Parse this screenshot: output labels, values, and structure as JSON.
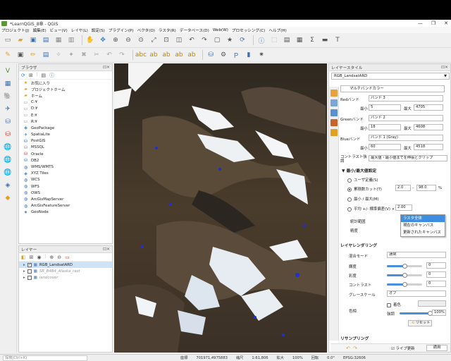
{
  "window": {
    "title": "*LearnQGIS_8章 - QGIS",
    "controls": [
      "—",
      "❐",
      "✕"
    ]
  },
  "menu": [
    "プロジェクト(J)",
    "編集(E)",
    "ビュー(V)",
    "レイヤ(L)",
    "設定(S)",
    "プラグイン(P)",
    "ベクタ(O)",
    "ラスタ(R)",
    "データベース(D)",
    "Web(W)",
    "プロセッシング(C)",
    "ヘルプ(H)"
  ],
  "browser": {
    "title": "ブラウザ",
    "items": [
      {
        "icon": "star-icon",
        "label": "お気に入り"
      },
      {
        "icon": "folder-icon",
        "label": "プロジェクトホーム"
      },
      {
        "icon": "folder-icon",
        "label": "ホーム"
      },
      {
        "icon": "drive-icon",
        "label": "C:¥"
      },
      {
        "icon": "drive-icon",
        "label": "D:¥"
      },
      {
        "icon": "drive-icon",
        "label": "E:¥"
      },
      {
        "icon": "drive-icon",
        "label": "R:¥"
      },
      {
        "icon": "geopackage-icon",
        "label": "GeoPackage"
      },
      {
        "icon": "spatialite-icon",
        "label": "SpatiaLite"
      },
      {
        "icon": "postgis-icon",
        "label": "PostGIS"
      },
      {
        "icon": "mssql-icon",
        "label": "MSSQL"
      },
      {
        "icon": "oracle-icon",
        "label": "Oracle"
      },
      {
        "icon": "db2-icon",
        "label": "DB2"
      },
      {
        "icon": "wms-icon",
        "label": "WMS/WMTS"
      },
      {
        "icon": "xyz-icon",
        "label": "XYZ Tiles"
      },
      {
        "icon": "wcs-icon",
        "label": "WCS"
      },
      {
        "icon": "wfs-icon",
        "label": "WFS"
      },
      {
        "icon": "ows-icon",
        "label": "OWS"
      },
      {
        "icon": "arcgis-icon",
        "label": "ArcGisMapServer"
      },
      {
        "icon": "arcgis-icon",
        "label": "ArcGisFeatureServer"
      },
      {
        "icon": "geonode-icon",
        "label": "GeoNode"
      }
    ]
  },
  "layers": {
    "title": "レイヤー",
    "items": [
      {
        "label": "RGB_LandsatARD",
        "checked": true,
        "selected": true,
        "dim": false
      },
      {
        "label": "SR_B4B4_Alaska_rast",
        "checked": false,
        "selected": false,
        "dim": true
      },
      {
        "label": "landcover",
        "checked": false,
        "selected": false,
        "dim": true
      }
    ]
  },
  "style": {
    "title": "レイヤースタイル",
    "layer": "RGB_LandsatARD",
    "renderer": "マルチバンドカラー",
    "red": {
      "label": "Redバンド",
      "band": "バンド 3",
      "min_label": "最小",
      "min": "5",
      "max_label": "最大",
      "max": "4705"
    },
    "green": {
      "label": "Greenバンド",
      "band": "バンド 2",
      "min_label": "最小",
      "min": "18",
      "max_label": "最大",
      "max": "4608"
    },
    "blue": {
      "label": "Blueバンド",
      "band": "バンド 1 (Gray)",
      "min_label": "最小",
      "min": "60",
      "max_label": "最大",
      "max": "4518"
    },
    "contrast_label": "コントラスト強調",
    "contrast_value": "最大値・最小値までを伸張とクリップ",
    "minmax_section": "最小/最大値設定",
    "user_defined": "ユーザ定義(S)",
    "cumulative": "累積数カット(T)",
    "cum_low": "2.0",
    "cum_high": "98.0",
    "percent": "%",
    "minmax": "最小 / 最大(M)",
    "meanstd": "平均 +/- 標準偏差(V) ×",
    "meanstd_value": "2.00",
    "extent_label": "統計範囲",
    "accuracy_label": "精度",
    "render_section": "レイヤレンダリング",
    "blend_label": "混合モード",
    "blend_value": "通常",
    "brightness_label": "輝度",
    "brightness": "0",
    "saturation_label": "彩度",
    "saturation": "0",
    "contrast2_label": "コントラスト",
    "contrast2": "0",
    "grayscale_label": "グレースケール",
    "grayscale_value": "オフ",
    "colorize_label": "着色",
    "hue_label": "色相",
    "strength_label": "強調",
    "strength_value": "100%",
    "reset": "リセット",
    "resampling": "リサンプリング",
    "live_update": "ライブ更新",
    "apply": "適用"
  },
  "extent_popup": [
    "ラスタ全体",
    "現在のキャンバス",
    "更新されたキャンバス"
  ],
  "status": {
    "search": "探検(Ctrl+K)",
    "coord_label": "座標",
    "coord": "701971,4975883",
    "scale_label": "縮尺",
    "scale": "1:61,806",
    "zoom_label": "拡大",
    "zoom": "100%",
    "rotation_label": "回転",
    "rotation": "0.0°",
    "epsg": "EPSG:32606"
  }
}
